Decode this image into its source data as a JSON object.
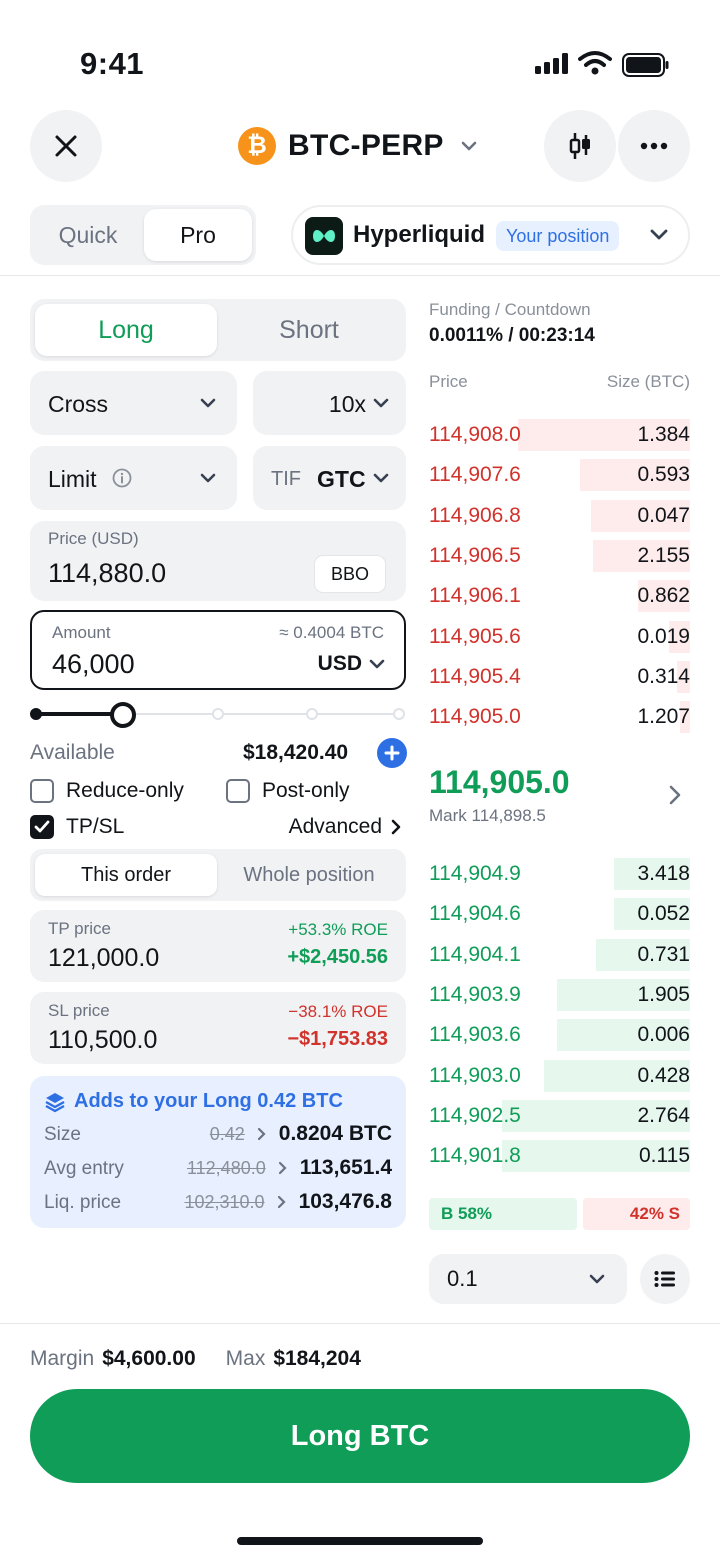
{
  "status_bar": {
    "time": "9:41"
  },
  "header": {
    "pair_title": "BTC-PERP",
    "coin_symbol": "₿"
  },
  "mode": {
    "quick": "Quick",
    "pro": "Pro"
  },
  "exchange": {
    "name": "Hyperliquid",
    "badge": "Your position"
  },
  "order_side": {
    "long": "Long",
    "short": "Short"
  },
  "margin_mode": {
    "value": "Cross"
  },
  "leverage": {
    "value": "10x"
  },
  "order_type": {
    "value": "Limit"
  },
  "tif": {
    "label": "TIF",
    "value": "GTC"
  },
  "price_field": {
    "label": "Price (USD)",
    "value": "114,880.0",
    "bbo": "BBO"
  },
  "amount_field": {
    "label": "Amount",
    "approx": "≈ 0.4004 BTC",
    "value": "46,000",
    "unit": "USD"
  },
  "slider": {
    "fraction": 0.25
  },
  "available": {
    "label": "Available",
    "value": "$18,420.40"
  },
  "options": {
    "reduce_only": {
      "label": "Reduce-only",
      "checked": false
    },
    "post_only": {
      "label": "Post-only",
      "checked": false
    },
    "tpsl": {
      "label": "TP/SL",
      "checked": true
    },
    "advanced": "Advanced"
  },
  "tpsl_scope": {
    "this_order": "This order",
    "whole_position": "Whole position"
  },
  "tp": {
    "label": "TP price",
    "value": "121,000.0",
    "roe": "+53.3% ROE",
    "pnl": "+$2,450.56"
  },
  "sl": {
    "label": "SL price",
    "value": "110,500.0",
    "roe": "−38.1% ROE",
    "pnl": "−$1,753.83"
  },
  "summary": {
    "title": "Adds to your Long 0.42 BTC",
    "size": {
      "label": "Size",
      "old": "0.42",
      "new": "0.8204 BTC"
    },
    "avg_entry": {
      "label": "Avg entry",
      "old": "112,480.0",
      "new": "113,651.4"
    },
    "liq_price": {
      "label": "Liq. price",
      "old": "102,310.0",
      "new": "103,476.8"
    }
  },
  "funding": {
    "label": "Funding / Countdown",
    "value": "0.0011% / 00:23:14"
  },
  "orderbook": {
    "price_header": "Price",
    "size_header": "Size (BTC)",
    "asks": [
      {
        "price": "114,908.0",
        "size": "1.384",
        "depth": 0.66
      },
      {
        "price": "114,907.6",
        "size": "0.593",
        "depth": 0.42
      },
      {
        "price": "114,906.8",
        "size": "0.047",
        "depth": 0.38
      },
      {
        "price": "114,906.5",
        "size": "2.155",
        "depth": 0.37
      },
      {
        "price": "114,906.1",
        "size": "0.862",
        "depth": 0.2
      },
      {
        "price": "114,905.6",
        "size": "0.019",
        "depth": 0.08
      },
      {
        "price": "114,905.4",
        "size": "0.314",
        "depth": 0.05
      },
      {
        "price": "114,905.0",
        "size": "1.207",
        "depth": 0.04
      }
    ],
    "mid_price": "114,905.0",
    "mark": "Mark 114,898.5",
    "bids": [
      {
        "price": "114,904.9",
        "size": "3.418",
        "depth": 0.29
      },
      {
        "price": "114,904.6",
        "size": "0.052",
        "depth": 0.29
      },
      {
        "price": "114,904.1",
        "size": "0.731",
        "depth": 0.36
      },
      {
        "price": "114,903.9",
        "size": "1.905",
        "depth": 0.51
      },
      {
        "price": "114,903.6",
        "size": "0.006",
        "depth": 0.51
      },
      {
        "price": "114,903.0",
        "size": "0.428",
        "depth": 0.56
      },
      {
        "price": "114,902.5",
        "size": "2.764",
        "depth": 0.72
      },
      {
        "price": "114,901.8",
        "size": "0.115",
        "depth": 0.72
      }
    ],
    "buy_ratio": "B 58%",
    "sell_ratio": "42% S",
    "tick_size": "0.1"
  },
  "footer": {
    "margin_label": "Margin",
    "margin_value": "$4,600.00",
    "max_label": "Max",
    "max_value": "$184,204",
    "cta": "Long BTC"
  },
  "colors": {
    "green": "#0f9d58",
    "red": "#d1322b",
    "blue": "#2f6fe4",
    "field_bg": "#f1f2f4"
  }
}
